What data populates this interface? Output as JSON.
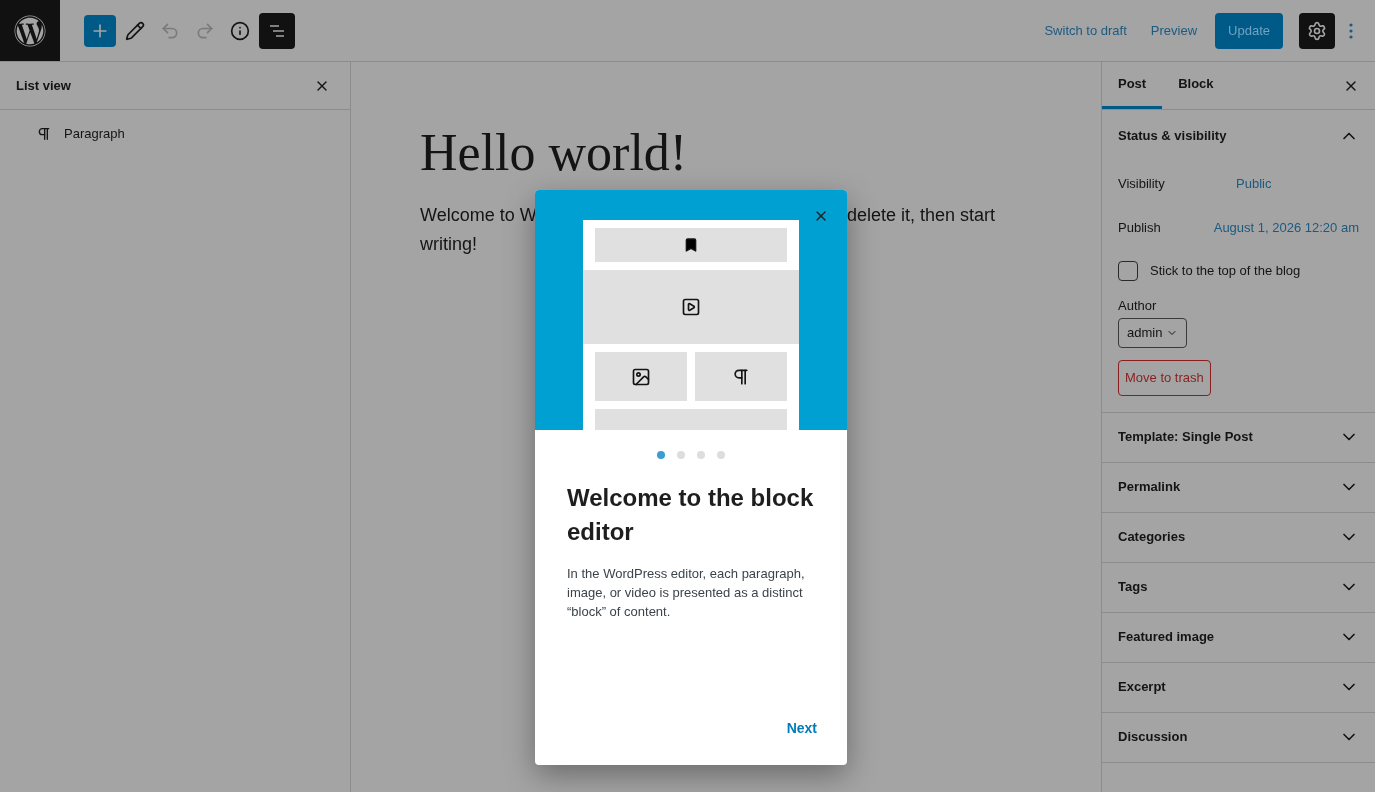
{
  "toolbar": {
    "add": {
      "active": true
    },
    "undo": {
      "disabled": true
    },
    "redo": {
      "disabled": true
    },
    "list_view": {
      "active": true
    },
    "actions": [
      "Switch to draft",
      "Preview"
    ],
    "update_button": "Update",
    "settings": {
      "active": true
    }
  },
  "list_view": {
    "title": "List view",
    "items": [
      {
        "label": "Paragraph"
      }
    ]
  },
  "post": {
    "title": "Hello world!",
    "paragraph_lines": [
      [
        "Welcome to W",
        "delete it, then start"
      ],
      [
        "writing!"
      ]
    ]
  },
  "sidebar": {
    "tabs": [
      {
        "label": "Post",
        "selected": true
      },
      {
        "label": "Block",
        "selected": false
      }
    ],
    "status": {
      "title": "Status & visibility",
      "expanded": true,
      "visibility_label": "Visibility",
      "visibility": "Public",
      "publish_label": "Publish",
      "publish": "August 1, 2026 12:20 am",
      "sticky": {
        "label": "Stick to the top of the blog",
        "checked": false
      },
      "author_label": "Author",
      "author": "admin",
      "trash": "Move to trash"
    },
    "panels": [
      {
        "title": "Template: Single Post",
        "expanded": false
      },
      {
        "title": "Permalink",
        "expanded": false
      },
      {
        "title": "Categories",
        "expanded": false
      },
      {
        "title": "Tags",
        "expanded": false
      },
      {
        "title": "Featured image",
        "expanded": false
      },
      {
        "title": "Excerpt",
        "expanded": false
      },
      {
        "title": "Discussion",
        "expanded": false
      }
    ]
  },
  "guide": {
    "pages": [
      {
        "selected": true
      },
      {
        "selected": false
      },
      {
        "selected": false
      },
      {
        "selected": false
      }
    ],
    "title": "Welcome to the block editor",
    "body": "In the WordPress editor, each paragraph, image, or video is presented as a distinct “block” of content.",
    "next": "Next"
  }
}
